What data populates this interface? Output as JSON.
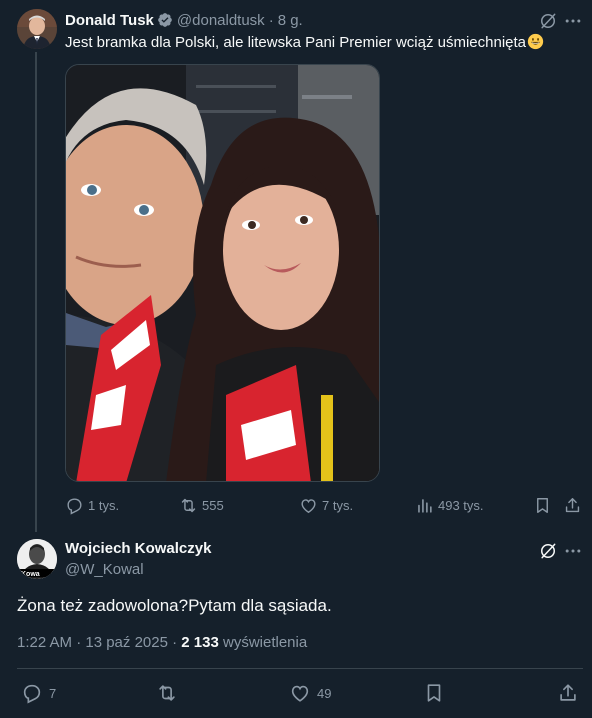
{
  "post": {
    "author_name": "Donald Tusk",
    "handle": "@donaldtusk",
    "time": "8 g.",
    "text": "Jest bramka dla Polski, ale litewska Pani Premier wciąż uśmiechnięta",
    "emoji": "grinning-face-emoji",
    "stats": {
      "replies": "1 tys.",
      "reposts": "555",
      "likes": "7 tys.",
      "views": "493 tys."
    }
  },
  "reply": {
    "author_name": "Wojciech Kowalczyk",
    "handle": "@W_Kowal",
    "text": "Żona też zadowolona?Pytam dla sąsiada.",
    "timestamp": "1:22 AM · 13 paź 2025 · ",
    "views_count": "2 133",
    "views_label": " wyświetlenia",
    "stats": {
      "replies": "7",
      "likes": "49"
    }
  },
  "colors": {
    "background": "#15202b",
    "text": "#f7f9f9",
    "muted": "#8b98a5",
    "border": "#38444d",
    "verified": "#8b98a5"
  },
  "icons": [
    "grok-icon",
    "more-icon",
    "verified-badge-icon",
    "reply-icon",
    "repost-icon",
    "like-icon",
    "views-icon",
    "bookmark-icon",
    "share-icon"
  ]
}
